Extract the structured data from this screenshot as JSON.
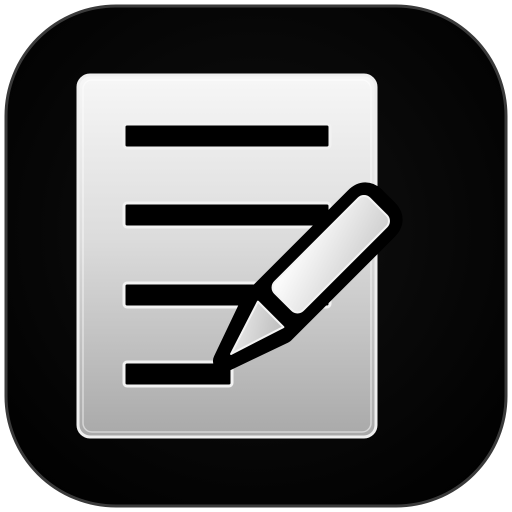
{
  "icon": {
    "name": "edit-document-icon",
    "background_color": "#000000",
    "page_color": "#d9d9d9",
    "line_color": "#000000",
    "pencil_color": "#e6e6e6",
    "line_count": 4
  }
}
